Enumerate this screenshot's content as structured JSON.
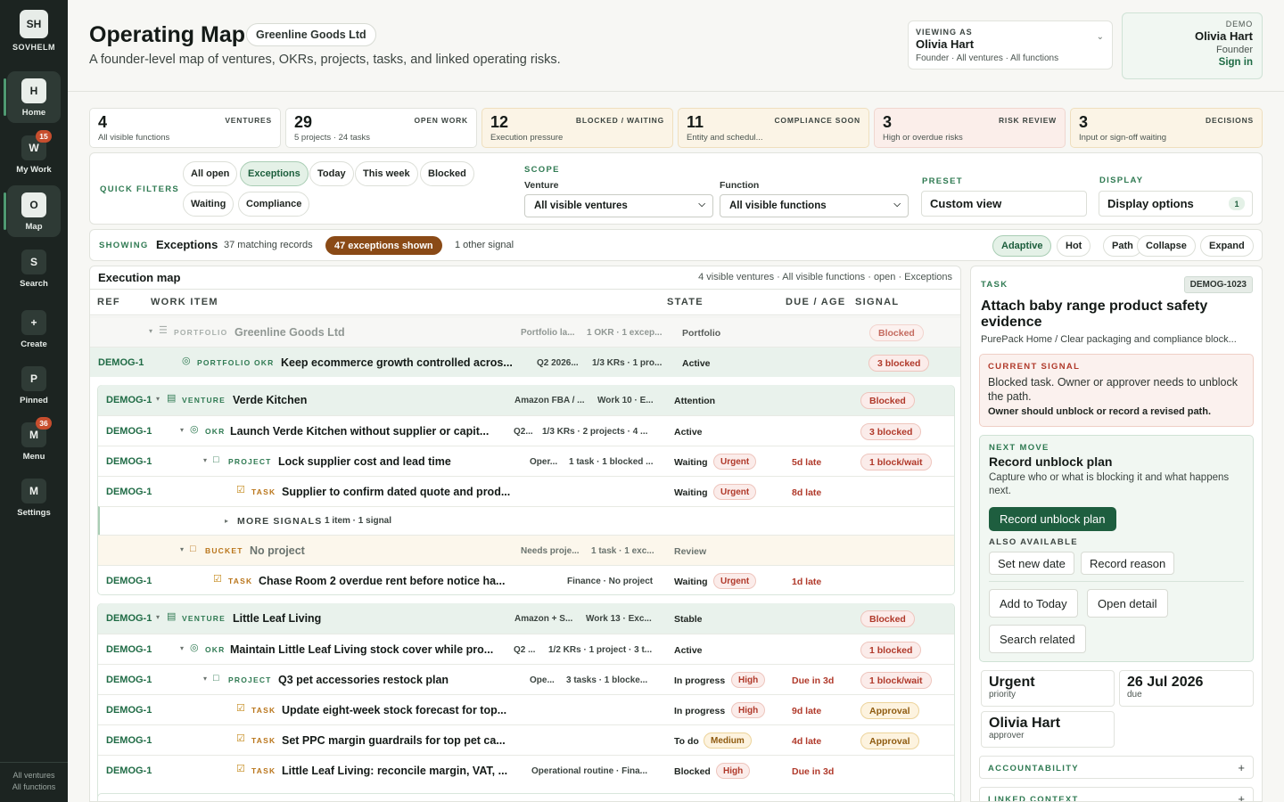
{
  "sidebar": {
    "logo": "SH",
    "brand": "SOVHELM",
    "items": [
      {
        "letter": "H",
        "label": "Home",
        "badge": ""
      },
      {
        "letter": "W",
        "label": "My Work",
        "badge": "15"
      },
      {
        "letter": "O",
        "label": "Map",
        "badge": ""
      },
      {
        "letter": "S",
        "label": "Search",
        "badge": ""
      },
      {
        "letter": "+",
        "label": "Create",
        "badge": ""
      },
      {
        "letter": "P",
        "label": "Pinned",
        "badge": ""
      },
      {
        "letter": "M",
        "label": "Menu",
        "badge": "36"
      },
      {
        "letter": "M",
        "label": "Settings",
        "badge": ""
      }
    ],
    "footer_line1": "All ventures",
    "footer_line2": "All functions"
  },
  "header": {
    "title": "Operating Map",
    "org": "Greenline Goods Ltd",
    "subtitle": "A founder-level map of ventures, OKRs, projects, tasks, and linked operating risks.",
    "viewing_label": "VIEWING AS",
    "viewing_name": "Olivia Hart",
    "viewing_scope": "Founder · All ventures · All functions",
    "demo_label": "DEMO",
    "demo_name": "Olivia Hart",
    "demo_role": "Founder",
    "demo_action": "Sign in"
  },
  "metrics": [
    {
      "value": "4",
      "label": "VENTURES",
      "sub": "All visible functions",
      "tone": "n"
    },
    {
      "value": "29",
      "label": "OPEN WORK",
      "sub": "5 projects · 24 tasks",
      "tone": "n"
    },
    {
      "value": "12",
      "label": "BLOCKED / WAITING",
      "sub": "Execution pressure",
      "tone": "w"
    },
    {
      "value": "11",
      "label": "COMPLIANCE SOON",
      "sub": "Entity and schedul...",
      "tone": "w"
    },
    {
      "value": "3",
      "label": "RISK REVIEW",
      "sub": "High or overdue risks",
      "tone": "r"
    },
    {
      "value": "3",
      "label": "DECISIONS",
      "sub": "Input or sign-off waiting",
      "tone": "w"
    }
  ],
  "filters": {
    "quick_label": "QUICK FILTERS",
    "quick": [
      "All open",
      "Exceptions",
      "Today",
      "This week",
      "Blocked",
      "Waiting",
      "Compliance"
    ],
    "quick_selected": "Exceptions",
    "scope_label": "SCOPE",
    "venture_label": "Venture",
    "venture_value": "All visible ventures",
    "function_label": "Function",
    "function_value": "All visible functions",
    "preset_label": "PRESET",
    "preset_value": "Custom view",
    "display_label": "DISPLAY",
    "display_value": "Display options",
    "display_count": "1"
  },
  "showing": {
    "label": "SHOWING",
    "value": "Exceptions",
    "matching": "37 matching records",
    "badge": "47 exceptions shown",
    "other": "1 other signal",
    "views": [
      "Adaptive",
      "Hot",
      "Path",
      "Collapse",
      "Expand"
    ],
    "view_selected": "Adaptive"
  },
  "map": {
    "title": "Execution map",
    "meta": "4 visible ventures · All visible functions · open · Exceptions",
    "columns": [
      "REF",
      "WORK ITEM",
      "STATE",
      "DUE / AGE",
      "SIGNAL"
    ],
    "rows": [
      {
        "ref": "",
        "type": "PORTFOLIO",
        "title": "Greenline Goods Ltd",
        "ctx": "Portfolio la...",
        "ctx2": "1 OKR · 1 excep...",
        "state": "Portfolio",
        "priority": "",
        "due": "",
        "signal": "Blocked"
      },
      {
        "ref": "DEMOG-1",
        "type": "PORTFOLIO OKR",
        "title": "Keep ecommerce growth controlled acros...",
        "ctx": "Q2 2026...",
        "ctx2": "1/3 KRs · 1 pro...",
        "state": "Active",
        "priority": "",
        "due": "",
        "signal": "3 blocked"
      },
      {
        "ref": "DEMOG-1",
        "type": "VENTURE",
        "title": "Verde Kitchen",
        "ctx": "Amazon FBA / ...",
        "ctx2": "Work 10 · E...",
        "state": "Attention",
        "priority": "",
        "due": "",
        "signal": "Blocked"
      },
      {
        "ref": "DEMOG-1",
        "type": "OKR",
        "title": "Launch Verde Kitchen without supplier or capit...",
        "ctx": "Q2...",
        "ctx2": "1/3 KRs · 2 projects · 4 ...",
        "state": "Active",
        "priority": "",
        "due": "",
        "signal": "3 blocked"
      },
      {
        "ref": "DEMOG-1",
        "type": "PROJECT",
        "title": "Lock supplier cost and lead time",
        "ctx": "Oper...",
        "ctx2": "1 task · 1 blocked ...",
        "state": "Waiting",
        "priority": "Urgent",
        "due": "5d late",
        "signal": "1 block/wait"
      },
      {
        "ref": "DEMOG-1",
        "type": "TASK",
        "title": "Supplier to confirm dated quote and prod...",
        "ctx": "",
        "ctx2": "",
        "state": "Waiting",
        "priority": "Urgent",
        "due": "8d late",
        "signal": ""
      },
      {
        "ref": "",
        "type": "",
        "title": "MORE SIGNALS",
        "ctx": "1 item · 1 signal",
        "ctx2": "",
        "state": "",
        "priority": "",
        "due": "",
        "signal": ""
      },
      {
        "ref": "",
        "type": "BUCKET",
        "title": "No project",
        "ctx": "Needs proje...",
        "ctx2": "1 task · 1 exc...",
        "state": "Review",
        "priority": "",
        "due": "",
        "signal": ""
      },
      {
        "ref": "DEMOG-1",
        "type": "TASK",
        "title": "Chase Room 2 overdue rent before notice ha...",
        "ctx": "Finance · No project",
        "ctx2": "",
        "state": "Waiting",
        "priority": "Urgent",
        "due": "1d late",
        "signal": ""
      },
      {
        "ref": "DEMOG-1",
        "type": "VENTURE",
        "title": "Little Leaf Living",
        "ctx": "Amazon + S...",
        "ctx2": "Work 13 · Exc...",
        "state": "Stable",
        "priority": "",
        "due": "",
        "signal": "Blocked"
      },
      {
        "ref": "DEMOG-1",
        "type": "OKR",
        "title": "Maintain Little Leaf Living stock cover while pro...",
        "ctx": "Q2 ...",
        "ctx2": "1/2 KRs · 1 project · 3 t...",
        "state": "Active",
        "priority": "",
        "due": "",
        "signal": "1 blocked"
      },
      {
        "ref": "DEMOG-1",
        "type": "PROJECT",
        "title": "Q3 pet accessories restock plan",
        "ctx": "Ope...",
        "ctx2": "3 tasks · 1 blocke...",
        "state": "In progress",
        "priority": "High",
        "due": "Due in 3d",
        "signal": "1 block/wait"
      },
      {
        "ref": "DEMOG-1",
        "type": "TASK",
        "title": "Update eight-week stock forecast for top...",
        "ctx": "",
        "ctx2": "",
        "state": "In progress",
        "priority": "High",
        "due": "9d late",
        "signal": "Approval"
      },
      {
        "ref": "DEMOG-1",
        "type": "TASK",
        "title": "Set PPC margin guardrails for top pet ca...",
        "ctx": "",
        "ctx2": "",
        "state": "To do",
        "priority": "Medium",
        "due": "4d late",
        "signal": "Approval"
      },
      {
        "ref": "DEMOG-1",
        "type": "TASK",
        "title": "Little Leaf Living: reconcile margin, VAT, ...",
        "ctx": "Operational routine · Fina...",
        "ctx2": "",
        "state": "Blocked",
        "priority": "High",
        "due": "Due in 3d",
        "signal": ""
      }
    ]
  },
  "detail": {
    "kind": "TASK",
    "id": "DEMOG-1023",
    "title": "Attach baby range product safety evidence",
    "path": "PurePack Home / Clear packaging and compliance block...",
    "signal_label": "CURRENT SIGNAL",
    "signal_text": "Blocked task. Owner or approver needs to unblock the path.",
    "signal_action": "Owner should unblock or record a revised path.",
    "next_label": "NEXT MOVE",
    "next_title": "Record unblock plan",
    "next_text": "Capture who or what is blocking it and what happens next.",
    "primary_button": "Record unblock plan",
    "also_label": "ALSO AVAILABLE",
    "also_buttons": [
      "Set new date",
      "Record reason"
    ],
    "action_buttons": [
      "Add to Today",
      "Open detail",
      "Search related"
    ],
    "facts": [
      {
        "value": "Urgent",
        "label": "priority"
      },
      {
        "value": "26 Jul 2026",
        "label": "due"
      },
      {
        "value": "Olivia Hart",
        "label": "approver"
      }
    ],
    "sections": [
      "ACCOUNTABILITY",
      "LINKED CONTEXT"
    ],
    "expand_glyph": "+"
  },
  "colors": {
    "sidebar_bg": "#1c2421",
    "accent_green": "#2f7a52",
    "primary_button": "#1e5e3f",
    "danger": "#b0392a",
    "warning": "#8f5b10",
    "badge_brown": "#8a4a16"
  }
}
